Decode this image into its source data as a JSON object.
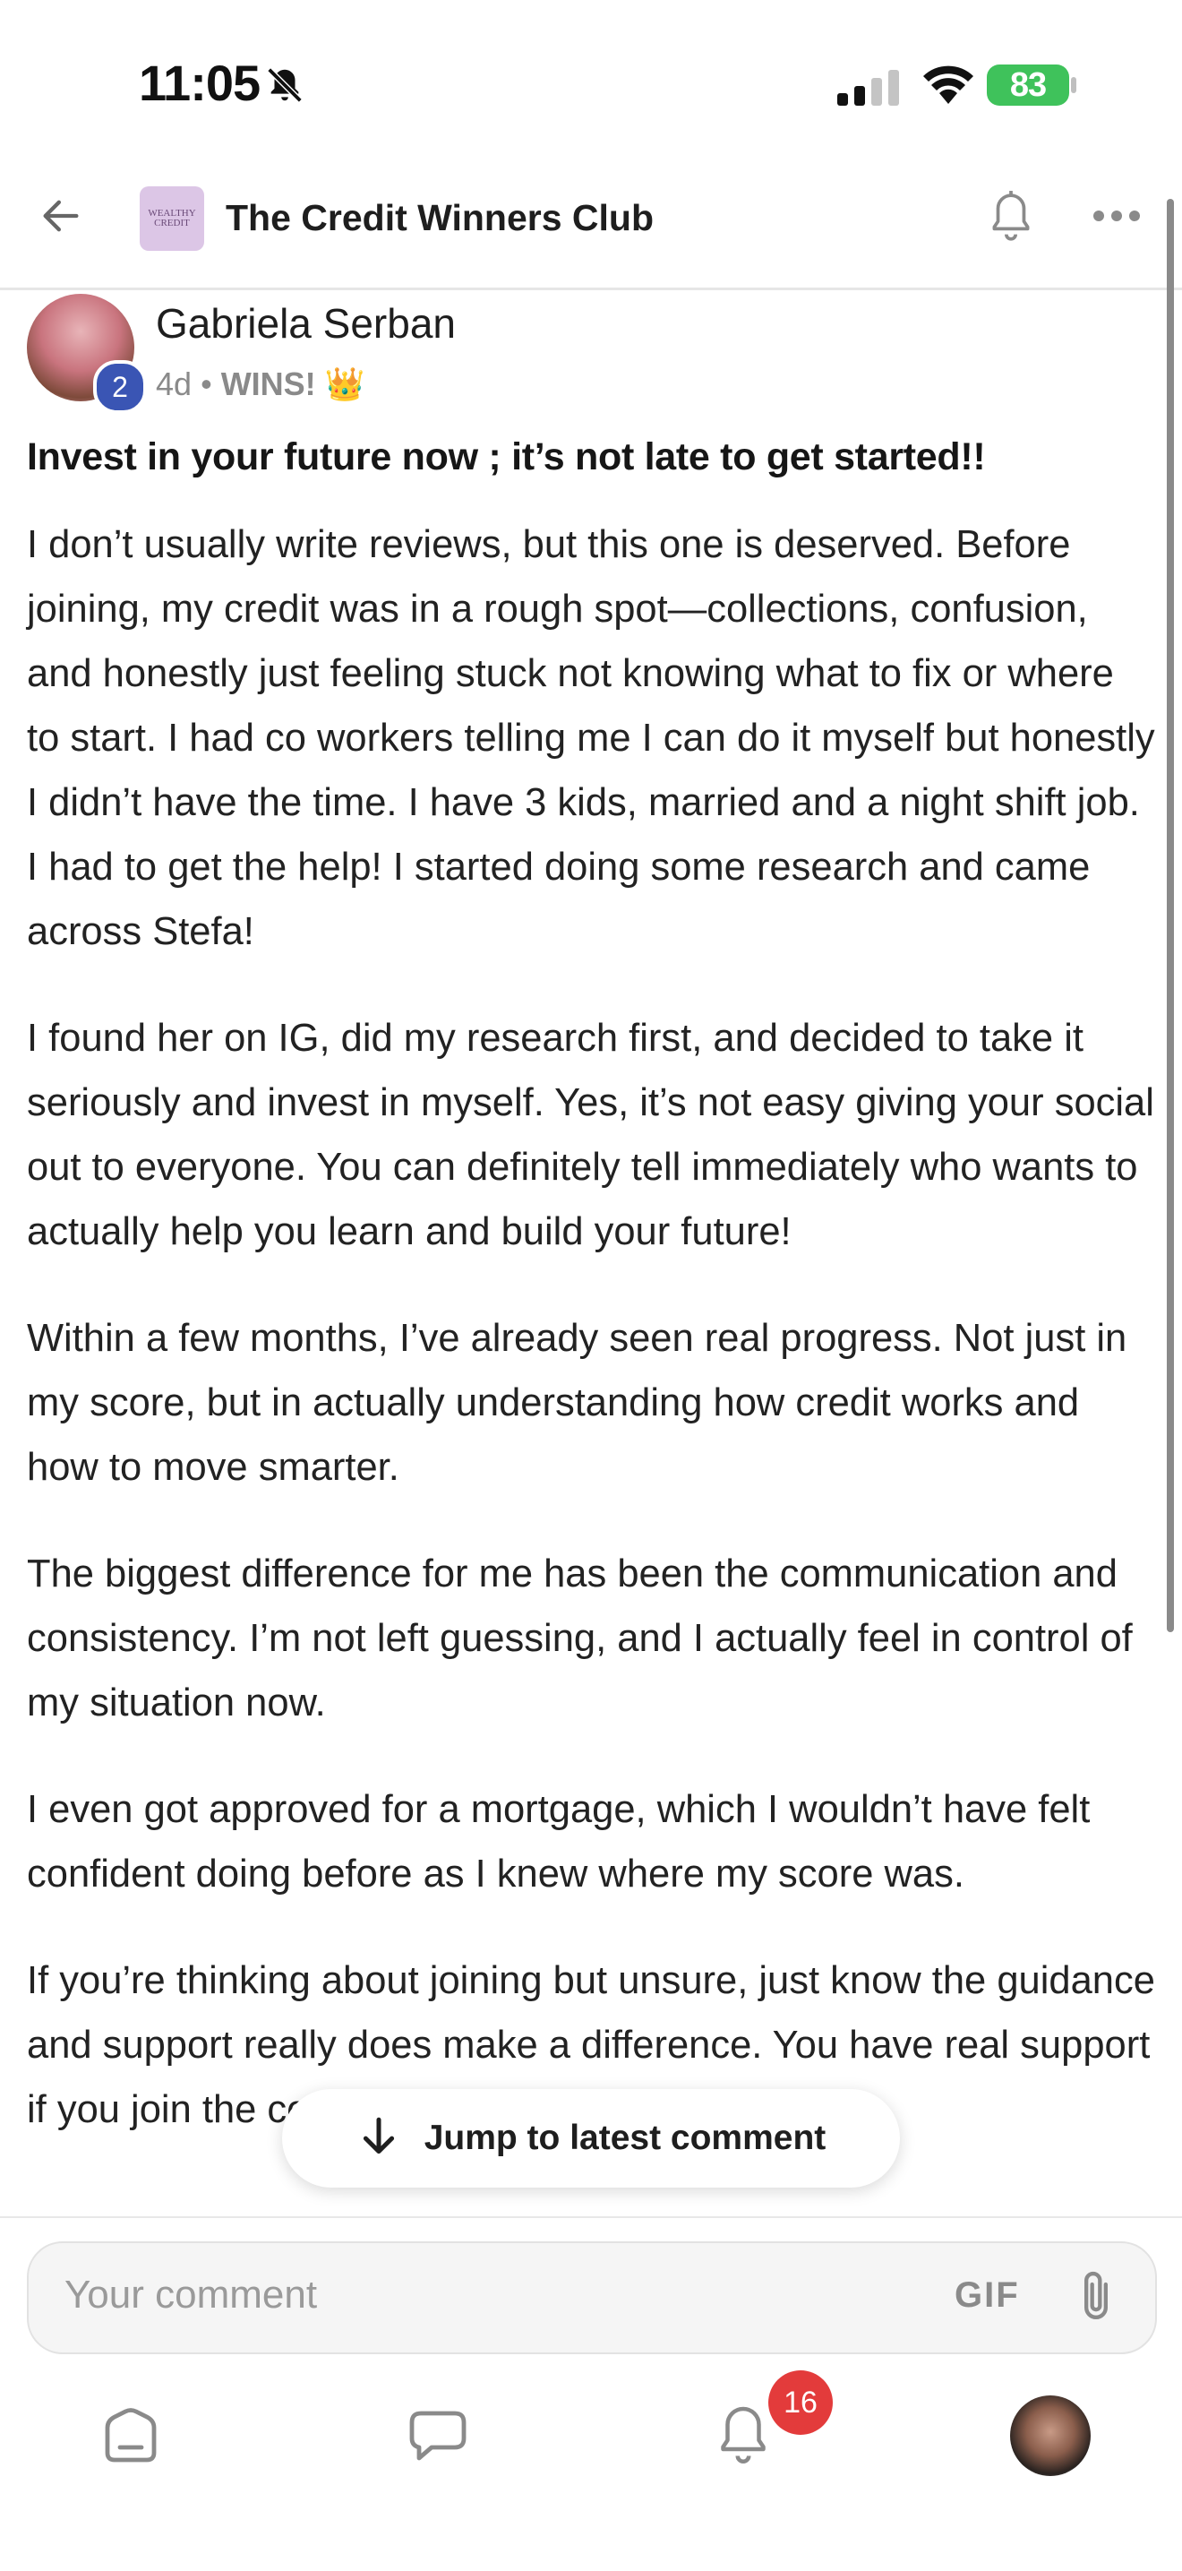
{
  "status_bar": {
    "time": "11:05",
    "battery": "83"
  },
  "header": {
    "group_name": "The Credit Winners Club",
    "logo_text": [
      "WEALTHY",
      "CREDIT"
    ]
  },
  "post": {
    "author": "Gabriela Serban",
    "level": "2",
    "age": "4d",
    "separator": "•",
    "category": "WINS! 👑",
    "title": "Invest in your future now ; it’s not late to get started!!",
    "paragraphs": [
      "I don’t usually write reviews, but this one is deserved. Before joining, my credit was in a rough spot—collections, confusion, and honestly just feeling stuck not knowing what to fix or where to start. I had co workers telling me I can do it myself but honestly I didn’t have the time. I have 3 kids, married and a night shift job. I had to get the help! I started doing some research and came across Stefa!",
      "I found her on IG, did my research first, and decided to take it seriously and invest in myself. Yes, it’s not easy giving your social out to everyone. You can definitely tell immediately who wants to actually help you learn and build your future!",
      "Within a few months, I’ve already seen real progress. Not just in my score, but in actually understanding how credit works and how to move smarter.",
      "The biggest difference for me has been the communication and consistency. I’m not left guessing, and I actually feel in control of my situation now.",
      "I even got approved for a mortgage, which I wouldn’t have felt confident doing before as I knew where my score was.",
      "If you’re thinking about joining but unsure, just know the guidance and support really does make a difference. You have real support if you join the correct team and Wealthy"
    ]
  },
  "jump_button": {
    "label": "Jump to latest comment"
  },
  "comment_box": {
    "placeholder": "Your comment",
    "gif_label": "GIF"
  },
  "bottom_nav": {
    "notification_count": "16"
  },
  "colors": {
    "accent_badge": "#3a55b4",
    "notification_badge": "#e33b3b",
    "battery": "#3fc25b"
  },
  "icons": [
    "bell-slash-icon",
    "signal-icon",
    "wifi-icon",
    "back-arrow-icon",
    "bell-icon",
    "more-icon",
    "arrow-down-icon",
    "paperclip-icon",
    "home-icon",
    "chat-icon",
    "notification-bell-icon"
  ]
}
